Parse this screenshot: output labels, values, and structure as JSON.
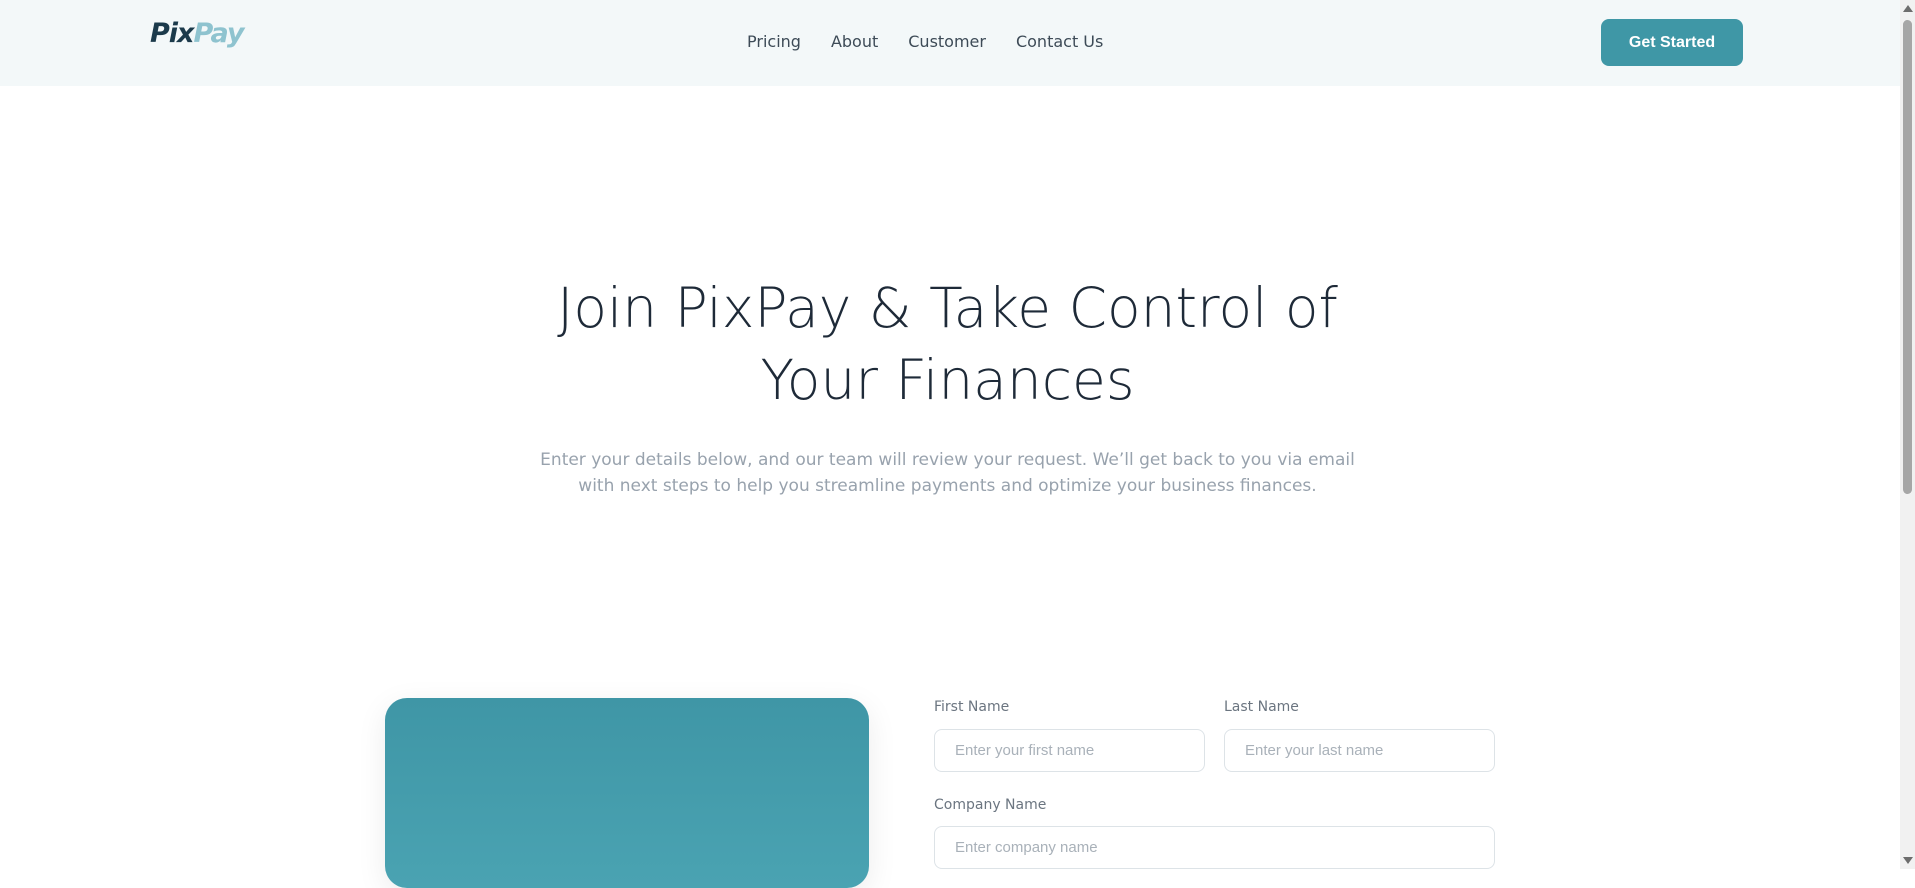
{
  "header": {
    "logo": {
      "part1": "Pix",
      "part2": "Pay"
    },
    "nav": [
      "Pricing",
      "About",
      "Customer",
      "Contact Us"
    ],
    "cta_label": "Get Started"
  },
  "hero": {
    "title_line1": "Join PixPay & Take Control of",
    "title_line2": "Your Finances",
    "subtitle_line1": "Enter your details below, and our team will review your request. We’ll get back to you via email",
    "subtitle_line2": "with next steps to help you streamline payments and optimize your business finances."
  },
  "form": {
    "first_name": {
      "label": "First Name",
      "placeholder": "Enter your first name",
      "value": ""
    },
    "last_name": {
      "label": "Last Name",
      "placeholder": "Enter your last name",
      "value": ""
    },
    "company_name": {
      "label": "Company Name",
      "placeholder": "Enter company name",
      "value": ""
    }
  },
  "colors": {
    "brand": "#3f97a6",
    "logo_dark": "#1b3a4b",
    "logo_light": "#8ec3cf",
    "header_bg": "#f3f8f9",
    "heading": "#1e2a38",
    "subtext": "#98a2ad"
  },
  "icons": {
    "scroll_up": "scroll-up-arrow-icon",
    "scroll_down": "scroll-down-arrow-icon"
  }
}
